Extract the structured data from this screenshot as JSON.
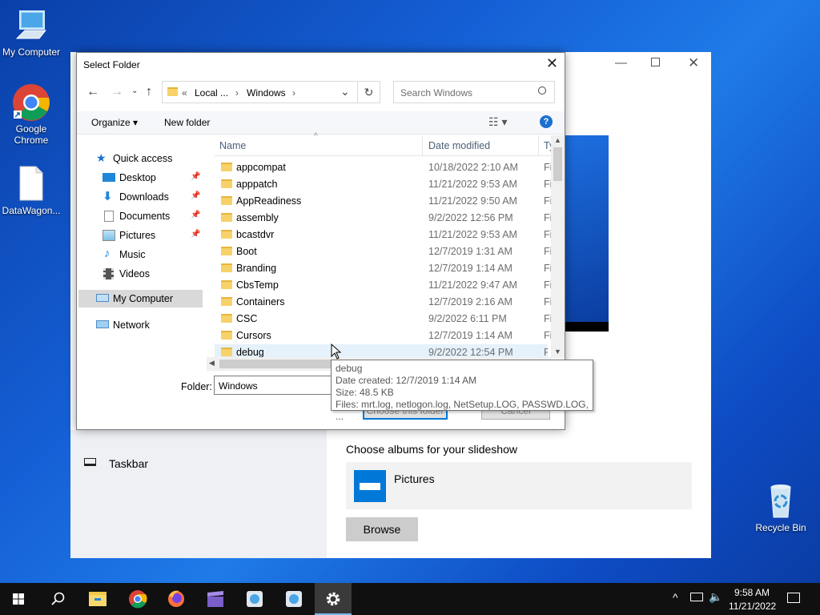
{
  "desktop": {
    "icons": [
      {
        "label": "My Computer"
      },
      {
        "label": "Google Chrome"
      },
      {
        "label": "DataWagon..."
      },
      {
        "label": "Recycle Bin"
      }
    ]
  },
  "dialog": {
    "title": "Select Folder",
    "address": {
      "overflow": "«",
      "parts": [
        "Local ...",
        "Windows"
      ]
    },
    "search_placeholder": "Search Windows",
    "toolbar": {
      "organize": "Organize ▾",
      "new_folder": "New folder"
    },
    "nav": {
      "quick_access": "Quick access",
      "items": [
        {
          "label": "Desktop",
          "pinned": true
        },
        {
          "label": "Downloads",
          "pinned": true
        },
        {
          "label": "Documents",
          "pinned": true
        },
        {
          "label": "Pictures",
          "pinned": true
        },
        {
          "label": "Music",
          "pinned": false
        },
        {
          "label": "Videos",
          "pinned": false
        }
      ],
      "my_computer": "My Computer",
      "network": "Network"
    },
    "columns": {
      "name": "Name",
      "date": "Date modified",
      "type": "Ty"
    },
    "rows": [
      {
        "name": "appcompat",
        "date": "10/18/2022 2:10 AM",
        "type": "Fi"
      },
      {
        "name": "apppatch",
        "date": "11/21/2022 9:53 AM",
        "type": "Fi"
      },
      {
        "name": "AppReadiness",
        "date": "11/21/2022 9:50 AM",
        "type": "Fi"
      },
      {
        "name": "assembly",
        "date": "9/2/2022 12:56 PM",
        "type": "Fi"
      },
      {
        "name": "bcastdvr",
        "date": "11/21/2022 9:53 AM",
        "type": "Fi"
      },
      {
        "name": "Boot",
        "date": "12/7/2019 1:31 AM",
        "type": "Fi"
      },
      {
        "name": "Branding",
        "date": "12/7/2019 1:14 AM",
        "type": "Fi"
      },
      {
        "name": "CbsTemp",
        "date": "11/21/2022 9:47 AM",
        "type": "Fi"
      },
      {
        "name": "Containers",
        "date": "12/7/2019 2:16 AM",
        "type": "Fi"
      },
      {
        "name": "CSC",
        "date": "9/2/2022 6:11 PM",
        "type": "Fi"
      },
      {
        "name": "Cursors",
        "date": "12/7/2019 1:14 AM",
        "type": "Fi"
      },
      {
        "name": "debug",
        "date": "9/2/2022 12:54 PM",
        "type": "Fi"
      }
    ],
    "folder_label": "Folder:",
    "folder_value": "Windows",
    "choose_button": "Choose this folder",
    "cancel_button": "Cancel",
    "tooltip": {
      "name": "debug",
      "created": "Date created: 12/7/2019 1:14 AM",
      "size": "Size: 48.5 KB",
      "files": "Files: mrt.log, netlogon.log, NetSetup.LOG, PASSWD.LOG, ..."
    }
  },
  "settings": {
    "taskbar_label": "Taskbar",
    "albums_label": "Choose albums for your slideshow",
    "album_name": "Pictures",
    "browse_button": "Browse"
  },
  "taskbar": {
    "time": "9:58 AM",
    "date": "11/21/2022"
  },
  "colors": {
    "accent": "#0078d7",
    "taskbar": "#101010",
    "folder": "#f7d16a"
  }
}
